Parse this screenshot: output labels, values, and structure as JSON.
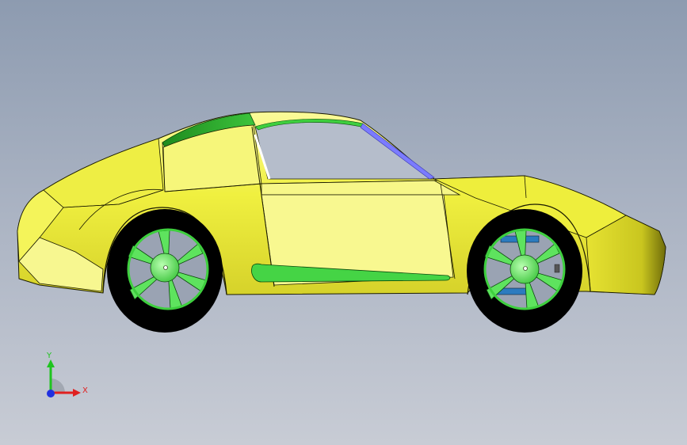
{
  "viewport": {
    "background_top": "#8d9bb0",
    "background_bottom": "#c8ccd5"
  },
  "model": {
    "body_color": "#f2f24a",
    "highlight_color": "#3ecf3e",
    "glass_edge_color": "#6b6bff",
    "tire_color": "#000000"
  },
  "triad": {
    "y_label": "Y",
    "x_label": "X",
    "y_color": "#1fc41f",
    "x_color": "#e02020",
    "z_color": "#2030e0"
  }
}
